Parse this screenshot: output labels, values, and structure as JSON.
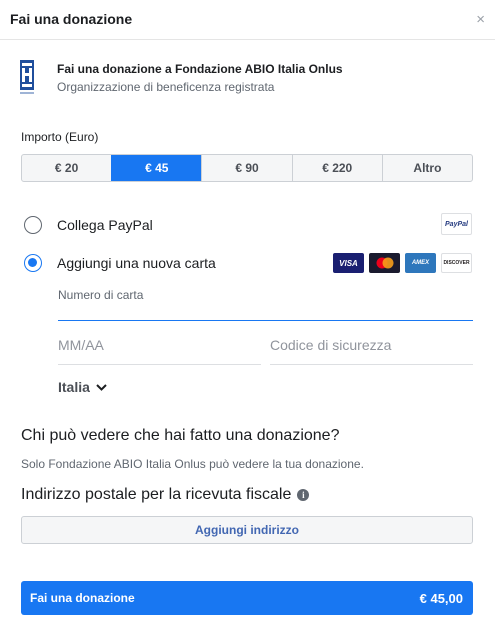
{
  "dialog": {
    "title": "Fai una donazione",
    "close_label": "×"
  },
  "organization": {
    "name": "Fai una donazione a Fondazione ABIO Italia Onlus",
    "subtitle": "Organizzazione di beneficenza registrata"
  },
  "amount": {
    "label": "Importo (Euro)",
    "options": [
      "€ 20",
      "€ 45",
      "€ 90",
      "€ 220",
      "Altro"
    ],
    "selected_index": 1
  },
  "payment": {
    "paypal_label": "Collega PayPal",
    "paypal_badge": "PayPal",
    "paypal_selected": false,
    "card_label": "Aggiungi una nuova carta",
    "card_selected": true,
    "card_brands": [
      "VISA",
      "mastercard",
      "AMEX",
      "DISCOVER"
    ]
  },
  "card_form": {
    "card_number_placeholder": "Numero di carta",
    "expiry_placeholder": "MM/AA",
    "security_code_placeholder": "Codice di sicurezza",
    "country": "Italia"
  },
  "visibility": {
    "title": "Chi può vedere che hai fatto una donazione?",
    "text": "Solo Fondazione ABIO Italia Onlus può vedere la tua donazione."
  },
  "address": {
    "title": "Indirizzo postale per la ricevuta fiscale",
    "button_label": "Aggiungi indirizzo"
  },
  "submit": {
    "label": "Fai una donazione",
    "total": "€ 45,00"
  },
  "colors": {
    "accent": "#1877f2",
    "link": "#4267b2"
  }
}
